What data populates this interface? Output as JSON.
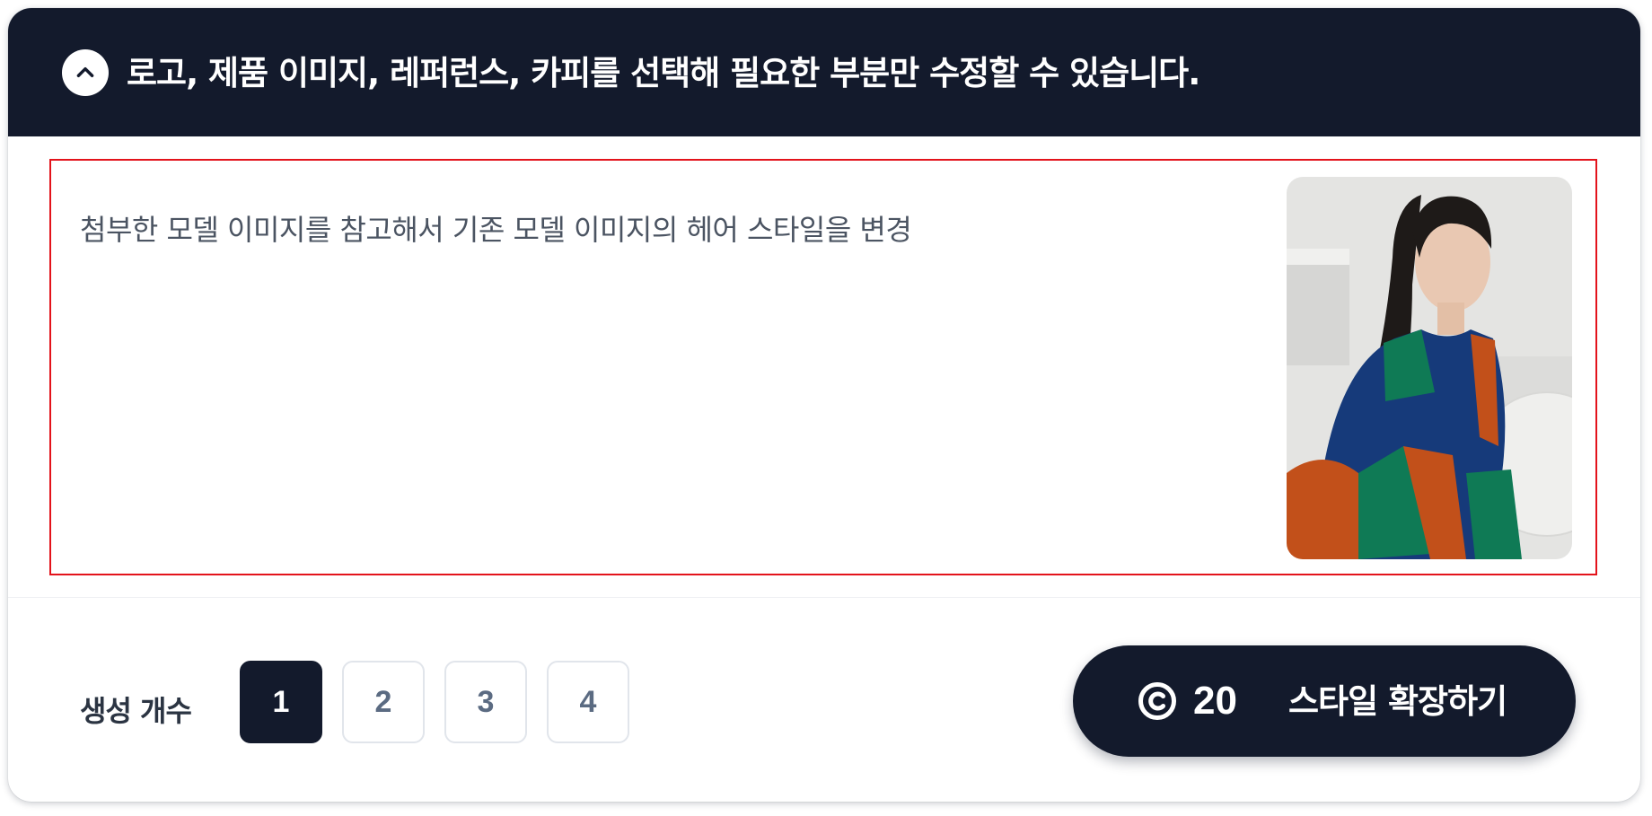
{
  "panel": {
    "title": "로고, 제품 이미지, 레퍼런스, 카피를 선택해 필요한 부분만 수정할 수 있습니다.",
    "collapse_icon": "chevron-up-icon"
  },
  "prompt": {
    "text": "첨부한 모델 이미지를 참고해서 기존 모델 이미지의 헤어 스타일을 변경",
    "reference_image": "model-reference-photo"
  },
  "generation": {
    "label": "생성 개수",
    "options": [
      "1",
      "2",
      "3",
      "4"
    ],
    "selected": "1"
  },
  "cta": {
    "credit_icon": "copyright-coin-icon",
    "credits": "20",
    "label": "스타일 확장하기"
  },
  "colors": {
    "header_bg": "#131a2c",
    "highlight_border": "#e3131b",
    "button_dark": "#131a2c"
  }
}
